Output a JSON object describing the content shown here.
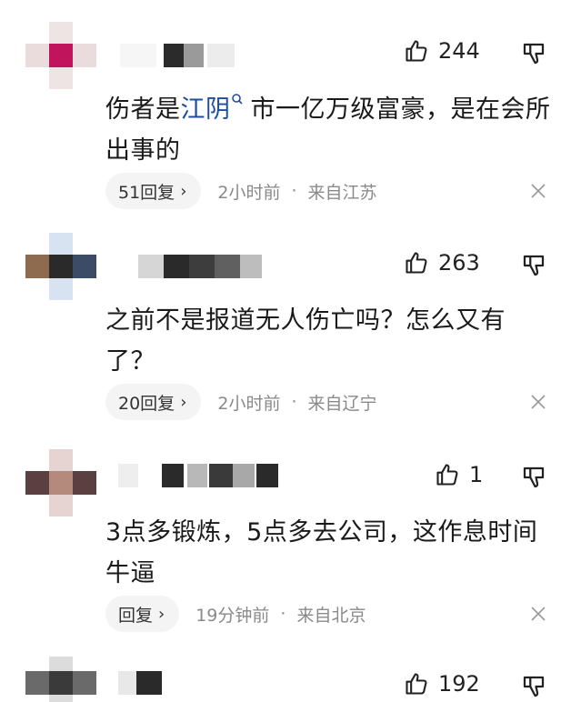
{
  "comments": [
    {
      "likes": "244",
      "text_before": "伤者是",
      "text_link": "江阴",
      "text_after": "市一亿万级富豪，是在会所出事的",
      "reply_label": "51回复",
      "time": "2小时前",
      "location": "来自江苏",
      "avatar_color": "#c0145c"
    },
    {
      "likes": "263",
      "text": "之前不是报道无人伤亡吗？怎么又有了？",
      "reply_label": "20回复",
      "time": "2小时前",
      "location": "来自辽宁",
      "avatar_color": "#2a2a2a"
    },
    {
      "likes": "1",
      "text": "3点多锻炼，5点多去公司，这作息时间牛逼",
      "reply_label": "回复",
      "time": "19分钟前",
      "location": "来自北京",
      "avatar_color": "#b48a7c"
    },
    {
      "likes": "192",
      "avatar_color": "#3a3a3a"
    }
  ],
  "separator": "·",
  "chevron": "›"
}
